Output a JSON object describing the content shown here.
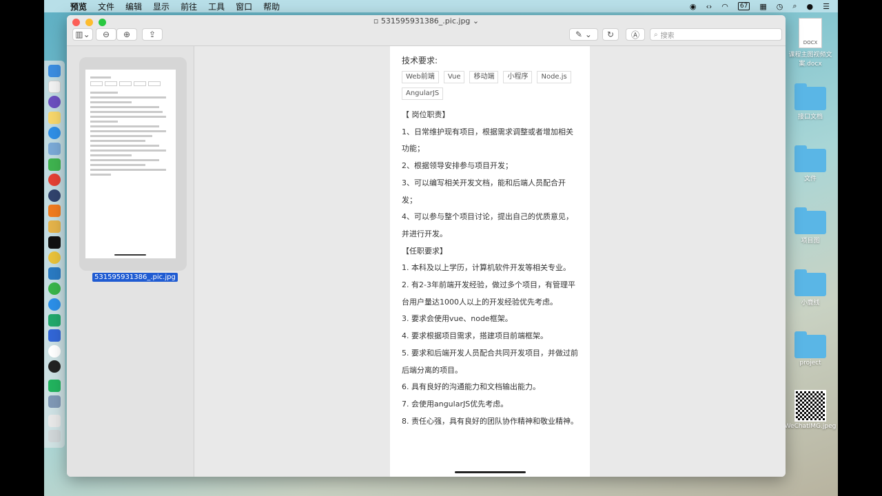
{
  "menubar": {
    "app_name": "预览",
    "items": [
      "文件",
      "编辑",
      "显示",
      "前往",
      "工具",
      "窗口",
      "帮助"
    ],
    "battery": "67"
  },
  "window": {
    "title": "531595931386_.pic.jpg",
    "search_placeholder": "搜索"
  },
  "sidebar": {
    "thumbnail_label": "531595931386_.pic.jpg"
  },
  "document": {
    "heading": "技术要求:",
    "tags": [
      "Web前端",
      "Vue",
      "移动端",
      "小程序",
      "Node.js",
      "AngularJS"
    ],
    "paragraphs": [
      "【 岗位职责】",
      "1、日常维护现有项目，根据需求调整或者增加相关功能；",
      "2、根据领导安排参与项目开发；",
      "3、可以编写相关开发文档，能和后端人员配合开发；",
      "4、可以参与整个项目讨论，提出自己的优质意见，并进行开发。",
      "【任职要求】",
      "1. 本科及以上学历，计算机软件开发等相关专业。",
      "2. 有2-3年前端开发经验，做过多个项目，有管理平台用户量达1000人以上的开发经验优先考虑。",
      "3. 要求会使用vue、node框架。",
      "4. 要求根据项目需求，搭建项目前端框架。",
      "5. 要求和后端开发人员配合共同开发项目，并做过前后端分离的项目。",
      "6. 具有良好的沟通能力和文档输出能力。",
      "7. 会使用angularJS优先考虑。",
      "8. 责任心强，具有良好的团队协作精神和敬业精神。"
    ]
  },
  "desktop": {
    "items": [
      {
        "label": "课程主图视频文案.docx",
        "kind": "docx"
      },
      {
        "label": "接口文档",
        "kind": "folder"
      },
      {
        "label": "文件",
        "kind": "folder"
      },
      {
        "label": "项目图",
        "kind": "folder"
      },
      {
        "label": "小鹿线",
        "kind": "folder"
      },
      {
        "label": "project",
        "kind": "folder"
      },
      {
        "label": "WeChatIMG.jpeg",
        "kind": "image"
      }
    ]
  },
  "icons": [
    "apple-icon",
    "sidebar-toggle-icon",
    "zoom-out-icon",
    "zoom-in-icon",
    "share-icon",
    "markup-pen-icon",
    "rotate-icon",
    "annotate-icon",
    "search-icon",
    "wifi-icon",
    "bluetooth-icon",
    "spotlight-icon",
    "notification-center-icon"
  ]
}
